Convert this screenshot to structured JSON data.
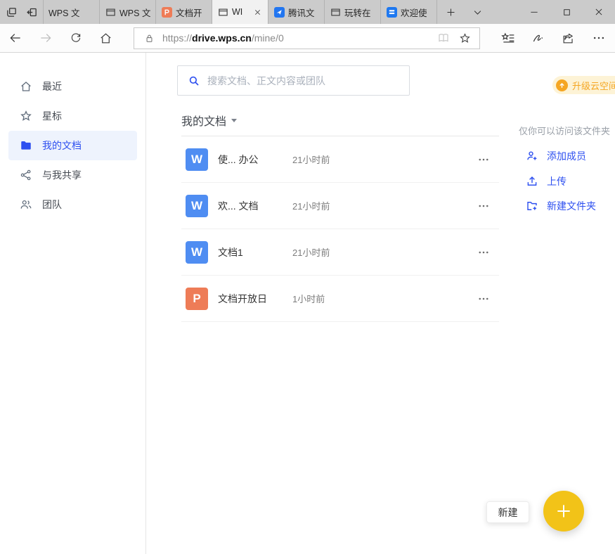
{
  "window": {
    "tabs": [
      {
        "title": "WPS 文",
        "icon": "none",
        "active": false
      },
      {
        "title": "WPS 文",
        "icon": "window",
        "active": false
      },
      {
        "title": "文档开",
        "icon": "wps-presentation",
        "active": false
      },
      {
        "title": "WI",
        "icon": "window",
        "active": true
      },
      {
        "title": "腾讯文",
        "icon": "tencent-docs",
        "active": false
      },
      {
        "title": "玩转在",
        "icon": "window",
        "active": false
      },
      {
        "title": "欢迎使",
        "icon": "wps-docs",
        "active": false
      }
    ]
  },
  "navbar": {
    "address": {
      "scheme": "https://",
      "domain": "drive.wps.cn",
      "path": "/mine/0"
    }
  },
  "sidebar": {
    "items": [
      {
        "label": "最近",
        "icon": "home",
        "active": false
      },
      {
        "label": "星标",
        "icon": "star",
        "active": false
      },
      {
        "label": "我的文档",
        "icon": "folder",
        "active": true
      },
      {
        "label": "与我共享",
        "icon": "share",
        "active": false
      },
      {
        "label": "团队",
        "icon": "team",
        "active": false
      }
    ]
  },
  "main": {
    "search_placeholder": "搜索文档、正文内容或团队",
    "section_title": "我的文档",
    "files": [
      {
        "name": "使... 办公",
        "time": "21小时前",
        "type": "writer",
        "badge": "W"
      },
      {
        "name": "欢... 文档",
        "time": "21小时前",
        "type": "writer",
        "badge": "W"
      },
      {
        "name": "文档1",
        "time": "21小时前",
        "type": "writer",
        "badge": "W"
      },
      {
        "name": "文档开放日",
        "time": "1小时前",
        "type": "presentation",
        "badge": "P"
      }
    ]
  },
  "right_panel": {
    "upgrade_label": "升级云空间",
    "access_note": "仅你可以访问该文件夹",
    "actions": [
      {
        "label": "添加成员",
        "icon": "person-plus"
      },
      {
        "label": "上传",
        "icon": "upload"
      },
      {
        "label": "新建文件夹",
        "icon": "folder-plus"
      }
    ]
  },
  "fab": {
    "tooltip": "新建"
  },
  "colors": {
    "accent": "#2e50f0",
    "writer-blue": "#4f8df2",
    "ppt-orange": "#ee7c57",
    "upgrade-orange": "#f5a623",
    "upgrade-bg": "#fdf3d6",
    "fab-yellow": "#f2c318",
    "active-bg": "#eef3fd"
  }
}
